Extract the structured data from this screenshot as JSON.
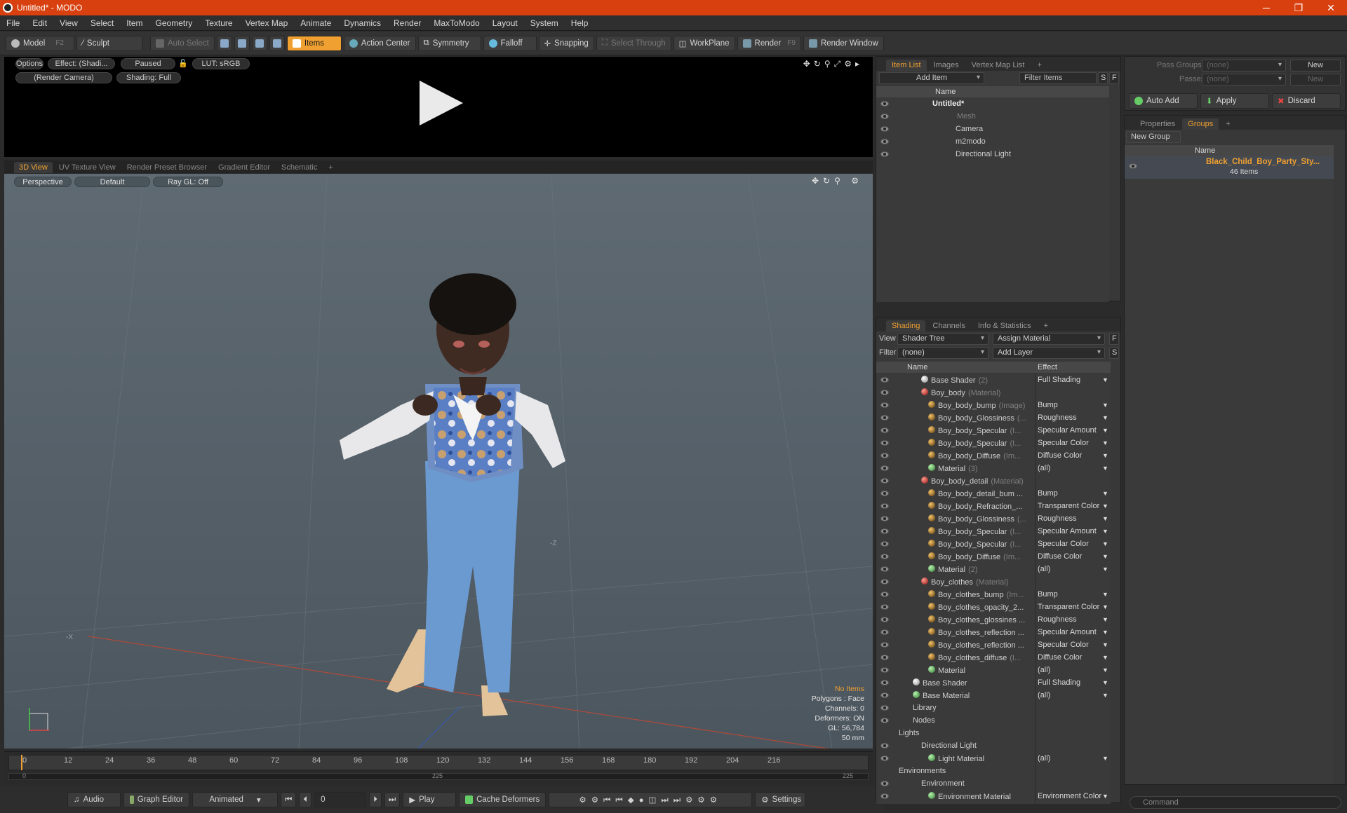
{
  "window": {
    "title": "Untitled* - MODO",
    "controls": [
      "─",
      "❐",
      "✕"
    ]
  },
  "menu": [
    "File",
    "Edit",
    "View",
    "Select",
    "Item",
    "Geometry",
    "Texture",
    "Vertex Map",
    "Animate",
    "Dynamics",
    "Render",
    "MaxToModo",
    "Layout",
    "System",
    "Help"
  ],
  "toolbar": {
    "model": "Model",
    "model_key": "F2",
    "sculpt": "Sculpt",
    "auto_select": "Auto Select",
    "items": "Items",
    "action_center": "Action Center",
    "symmetry": "Symmetry",
    "falloff": "Falloff",
    "snapping": "Snapping",
    "select_through": "Select Through",
    "workplane": "WorkPlane",
    "render": "Render",
    "render_key": "F9",
    "render_window": "Render Window"
  },
  "render_view": {
    "options": "Options",
    "effect": "Effect: (Shadi...",
    "paused": "Paused",
    "lut": "LUT: sRGB",
    "camera": "(Render Camera)",
    "shading": "Shading: Full"
  },
  "viewport_tabs": [
    "3D View",
    "UV Texture View",
    "Render Preset Browser",
    "Gradient Editor",
    "Schematic",
    "+"
  ],
  "viewport": {
    "projection": "Perspective",
    "style": "Default",
    "raygl": "Ray GL: Off",
    "axis_z": "-Z",
    "axis_x": "-X"
  },
  "stats": {
    "items": "No Items",
    "polygons": "Polygons : Face",
    "channels": "Channels: 0",
    "deformers": "Deformers: ON",
    "gl": "GL: 56,784",
    "focal": "50 mm"
  },
  "timeline": {
    "ticks": [
      "0",
      "12",
      "24",
      "36",
      "48",
      "60",
      "72",
      "84",
      "96",
      "108",
      "120",
      "132",
      "144",
      "156",
      "168",
      "180",
      "192",
      "204",
      "216"
    ],
    "start": "0",
    "mid": "225",
    "end": "225"
  },
  "bottombar": {
    "audio": "Audio",
    "graph_editor": "Graph Editor",
    "animated": "Animated",
    "frame": "0",
    "play": "Play",
    "cache": "Cache Deformers",
    "settings": "Settings"
  },
  "itemlist": {
    "tabs": [
      "Item List",
      "Images",
      "Vertex Map List",
      "+"
    ],
    "add_item": "Add Item",
    "filter": "Filter Items",
    "s": "S",
    "f": "F",
    "col_name": "Name",
    "items": [
      {
        "label": "Untitled*",
        "bold": true
      },
      {
        "label": "Mesh",
        "dim": true
      },
      {
        "label": "Camera"
      },
      {
        "label": "m2modo"
      },
      {
        "label": "Directional Light"
      }
    ]
  },
  "shading": {
    "tabs": [
      "Shading",
      "Channels",
      "Info & Statistics",
      "+"
    ],
    "view_label": "View",
    "view_value": "Shader Tree",
    "assign": "Assign Material",
    "f": "F",
    "filter_label": "Filter",
    "filter_value": "(none)",
    "add_layer": "Add Layer",
    "s": "S",
    "col_name": "Name",
    "col_effect": "Effect",
    "rows": [
      {
        "name": "Base Shader",
        "suffix": "(2)",
        "effect": "Full Shading",
        "icon": "shd",
        "indent": 1
      },
      {
        "name": "Boy_body",
        "suffix": "(Material)",
        "effect": "",
        "icon": "mat",
        "indent": 1
      },
      {
        "name": "Boy_body_bump",
        "suffix": "(Image)",
        "effect": "Bump",
        "icon": "img",
        "indent": 2
      },
      {
        "name": "Boy_body_Glossiness",
        "suffix": "(...",
        "effect": "Roughness",
        "icon": "img",
        "indent": 2
      },
      {
        "name": "Boy_body_Specular",
        "suffix": "(I...",
        "effect": "Specular Amount",
        "icon": "img",
        "indent": 2
      },
      {
        "name": "Boy_body_Specular",
        "suffix": "(I...",
        "effect": "Specular Color",
        "icon": "img",
        "indent": 2
      },
      {
        "name": "Boy_body_Diffuse",
        "suffix": "(Im...",
        "effect": "Diffuse Color",
        "icon": "img",
        "indent": 2
      },
      {
        "name": "Material",
        "suffix": "(3)",
        "effect": "(all)",
        "icon": "grn",
        "indent": 2
      },
      {
        "name": "Boy_body_detail",
        "suffix": "(Material)",
        "effect": "",
        "icon": "mat",
        "indent": 1
      },
      {
        "name": "Boy_body_detail_bum ...",
        "suffix": "",
        "effect": "Bump",
        "icon": "img",
        "indent": 2
      },
      {
        "name": "Boy_body_Refraction_...",
        "suffix": "",
        "effect": "Transparent Color",
        "icon": "img",
        "indent": 2
      },
      {
        "name": "Boy_body_Glossiness",
        "suffix": "(...",
        "effect": "Roughness",
        "icon": "img",
        "indent": 2
      },
      {
        "name": "Boy_body_Specular",
        "suffix": "(I...",
        "effect": "Specular Amount",
        "icon": "img",
        "indent": 2
      },
      {
        "name": "Boy_body_Specular",
        "suffix": "(I...",
        "effect": "Specular Color",
        "icon": "img",
        "indent": 2
      },
      {
        "name": "Boy_body_Diffuse",
        "suffix": "(Im...",
        "effect": "Diffuse Color",
        "icon": "img",
        "indent": 2
      },
      {
        "name": "Material",
        "suffix": "(2)",
        "effect": "(all)",
        "icon": "grn",
        "indent": 2
      },
      {
        "name": "Boy_clothes",
        "suffix": "(Material)",
        "effect": "",
        "icon": "mat",
        "indent": 1
      },
      {
        "name": "Boy_clothes_bump",
        "suffix": "(Im...",
        "effect": "Bump",
        "icon": "img",
        "indent": 2
      },
      {
        "name": "Boy_clothes_opacity_2...",
        "suffix": "",
        "effect": "Transparent Color",
        "icon": "img",
        "indent": 2
      },
      {
        "name": "Boy_clothes_glossines ...",
        "suffix": "",
        "effect": "Roughness",
        "icon": "img",
        "indent": 2
      },
      {
        "name": "Boy_clothes_reflection ...",
        "suffix": "",
        "effect": "Specular Amount",
        "icon": "img",
        "indent": 2
      },
      {
        "name": "Boy_clothes_reflection ...",
        "suffix": "",
        "effect": "Specular Color",
        "icon": "img",
        "indent": 2
      },
      {
        "name": "Boy_clothes_diffuse",
        "suffix": "(I...",
        "effect": "Diffuse Color",
        "icon": "img",
        "indent": 2
      },
      {
        "name": "Material",
        "suffix": "",
        "effect": "(all)",
        "icon": "grn",
        "indent": 2
      },
      {
        "name": "Base Shader",
        "suffix": "",
        "effect": "Full Shading",
        "icon": "shd",
        "indent": 0
      },
      {
        "name": "Base Material",
        "suffix": "",
        "effect": "(all)",
        "icon": "grn",
        "indent": 0
      },
      {
        "name": "Library",
        "suffix": "",
        "effect": "",
        "icon": "",
        "indent": 0
      },
      {
        "name": "Nodes",
        "suffix": "",
        "effect": "",
        "icon": "",
        "indent": 0
      },
      {
        "name": "Lights",
        "suffix": "",
        "effect": "",
        "icon": "",
        "indent": -1
      },
      {
        "name": "Directional Light",
        "suffix": "",
        "effect": "",
        "icon": "",
        "indent": 1
      },
      {
        "name": "Light Material",
        "suffix": "",
        "effect": "(all)",
        "icon": "grn",
        "indent": 2
      },
      {
        "name": "Environments",
        "suffix": "",
        "effect": "",
        "icon": "",
        "indent": -1
      },
      {
        "name": "Environment",
        "suffix": "",
        "effect": "",
        "icon": "",
        "indent": 1
      },
      {
        "name": "Environment Material",
        "suffix": "",
        "effect": "Environment Color",
        "icon": "grn",
        "indent": 2
      }
    ]
  },
  "passes": {
    "pass_groups": "Pass Groups",
    "passes": "Passes",
    "none": "(none)",
    "new": "New",
    "auto_add": "Auto Add",
    "apply": "Apply",
    "discard": "Discard"
  },
  "groups": {
    "tabs": [
      "Properties",
      "Groups",
      "+"
    ],
    "new_group": "New Group",
    "col_name": "Name",
    "group_name": "Black_Child_Boy_Party_Sty...",
    "group_count": "46 Items"
  },
  "command": {
    "placeholder": "Command"
  },
  "colors": {
    "accent": "#f0a030",
    "title": "#d8410f"
  }
}
